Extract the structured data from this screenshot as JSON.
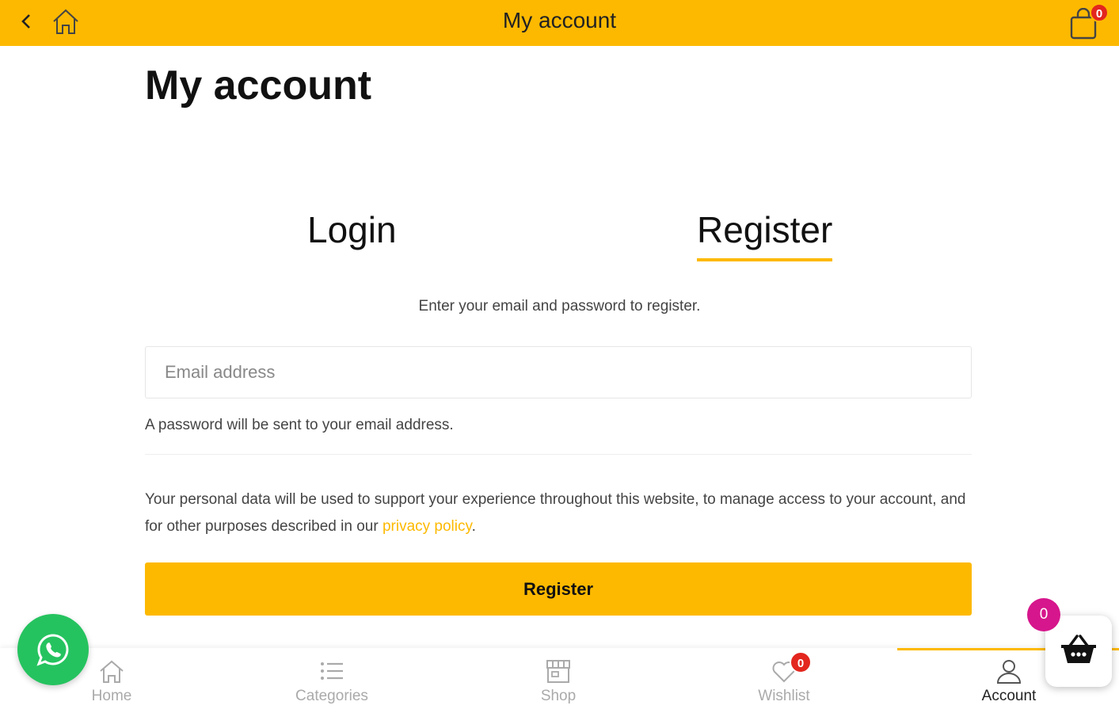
{
  "topbar": {
    "title": "My account",
    "cart_count": "0",
    "icons": [
      "back-arrow-icon",
      "home-icon",
      "shopping-bag-icon"
    ]
  },
  "main": {
    "page_title": "My account",
    "tabs": [
      {
        "label": "Login",
        "active": false
      },
      {
        "label": "Register",
        "active": true
      }
    ],
    "intro": "Enter your email and password to register.",
    "email_placeholder": "Email address",
    "password_note": "A password will be sent to your email address.",
    "privacy_text": "Your personal data will be used to support your experience throughout this website, to manage access to your account, and for other purposes described in our ",
    "privacy_link": "privacy policy",
    "privacy_end": ".",
    "register_button": "Register"
  },
  "bottom_nav": {
    "items": [
      {
        "label": "Home",
        "icon": "home-icon",
        "active": false
      },
      {
        "label": "Categories",
        "icon": "list-icon",
        "active": false
      },
      {
        "label": "Shop",
        "icon": "shop-icon",
        "active": false
      },
      {
        "label": "Wishlist",
        "icon": "heart-icon",
        "active": false,
        "badge": "0"
      },
      {
        "label": "Account",
        "icon": "user-icon",
        "active": true
      }
    ]
  },
  "floating": {
    "whatsapp_icon": "whatsapp-icon",
    "basket_icon": "basket-icon",
    "basket_count": "0"
  },
  "colors": {
    "accent": "#fdb900",
    "badge_red": "#e3261e",
    "basket_badge": "#d6168c",
    "whatsapp_green": "#25c35f"
  }
}
